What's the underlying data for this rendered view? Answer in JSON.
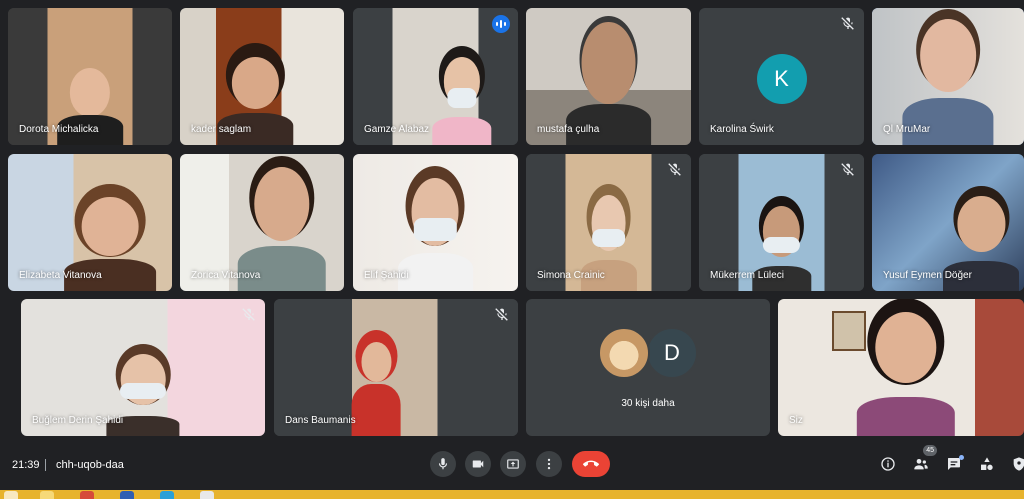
{
  "meeting": {
    "time": "21:39",
    "code": "chh-uqob-daa"
  },
  "participants": [
    {
      "name": "Dorota Michalicka"
    },
    {
      "name": "kader saglam"
    },
    {
      "name": "Gamze Alabaz"
    },
    {
      "name": "mustafa çulha"
    },
    {
      "name": "Karolina Świrk",
      "avatar_letter": "K"
    },
    {
      "name": "Ql MruMar"
    },
    {
      "name": "Elizabeta Vitanova"
    },
    {
      "name": "Zorica Vitanova"
    },
    {
      "name": "Elif Şahidi"
    },
    {
      "name": "Simona Crainic"
    },
    {
      "name": "Mükerrem Lüleci"
    },
    {
      "name": "Yusuf Eymen Döğer"
    },
    {
      "name": "Buğlem Derin Şahidi"
    },
    {
      "name": "Dans Baumanis"
    },
    {
      "name": "Siz"
    }
  ],
  "more_tile": {
    "label": "30 kişi daha",
    "avatar_letter": "D"
  },
  "controls": {
    "participants_count": "45"
  },
  "icons": [
    "mic-off-icon",
    "speaking-icon",
    "microphone-icon",
    "camera-icon",
    "present-icon",
    "more-options-icon",
    "end-call-icon",
    "info-icon",
    "people-icon",
    "chat-icon",
    "activities-icon",
    "host-controls-icon"
  ],
  "colors": {
    "background": "#202124",
    "tile": "#3c4043",
    "end_call": "#ea4335",
    "avatar_k": "#129eaf",
    "highlight": "#8ab4f8",
    "taskbar": "#e7b32e"
  }
}
